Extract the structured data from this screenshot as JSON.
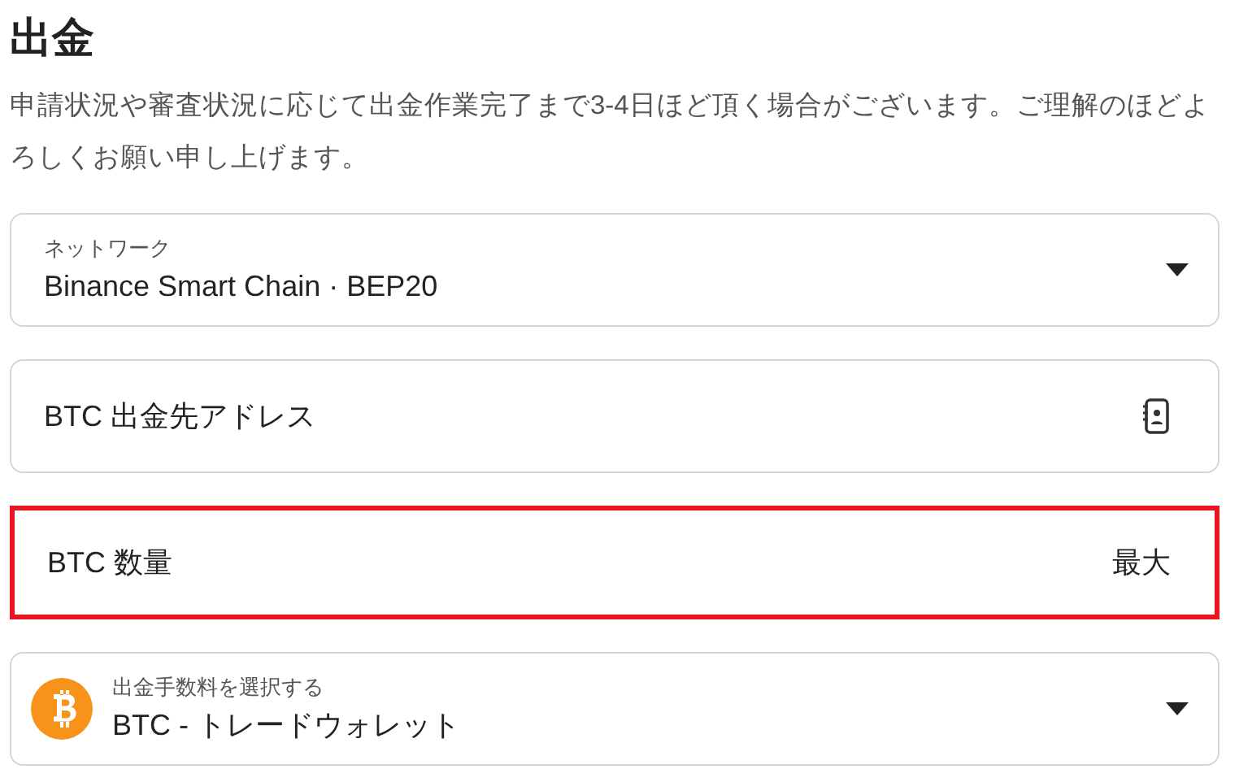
{
  "title": "出金",
  "description": "申請状況や審査状況に応じて出金作業完了まで3-4日ほど頂く場合がございます。ご理解のほどよろしくお願い申し上げます。",
  "fields": [
    {
      "kind": "select",
      "label": "ネットワーク",
      "value": "Binance Smart Chain · BEP20",
      "highlighted": false
    },
    {
      "kind": "book_input",
      "placeholder": "BTC 出金先アドレス",
      "highlighted": false
    },
    {
      "kind": "input",
      "placeholder": "BTC 数量",
      "action_text": "最大",
      "highlighted": true
    },
    {
      "kind": "coin_select",
      "label": "出金手数料を選択する",
      "value": "BTC - トレードウォレット",
      "highlighted": false
    }
  ]
}
